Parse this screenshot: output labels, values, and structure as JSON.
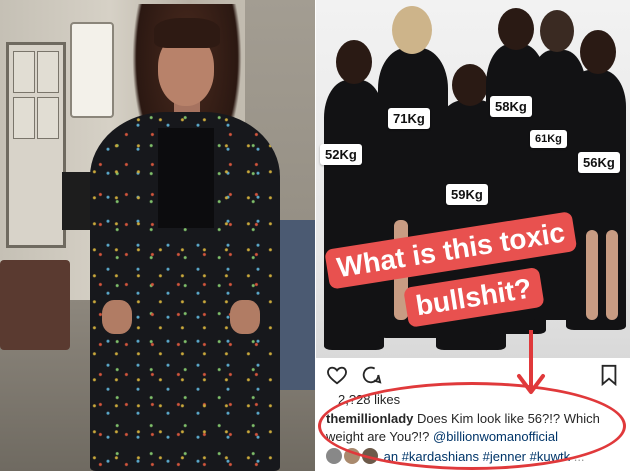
{
  "weights": {
    "w1": "52Kg",
    "w2": "71Kg",
    "w3": "58Kg",
    "w4": "61Kg",
    "w5": "56Kg",
    "w6": "59Kg"
  },
  "sticker": {
    "line1": "What is this toxic",
    "line2": "bullshit?"
  },
  "post": {
    "likes": "2,?28 likes",
    "username": "themillionlady",
    "caption_text": "Does Kim look like 56?!? Which weight are You?!?",
    "mention": "@billionwomanofficial",
    "hashtags": "an #kardashians #jenner #kuwtk",
    "more": "..."
  },
  "icons": {
    "heart": "heart-icon",
    "comment": "comment-icon",
    "bookmark": "bookmark-icon"
  },
  "colors": {
    "sticker_bg": "#e8514f",
    "annotation_red": "#e0393b",
    "mention_blue": "#003569"
  }
}
